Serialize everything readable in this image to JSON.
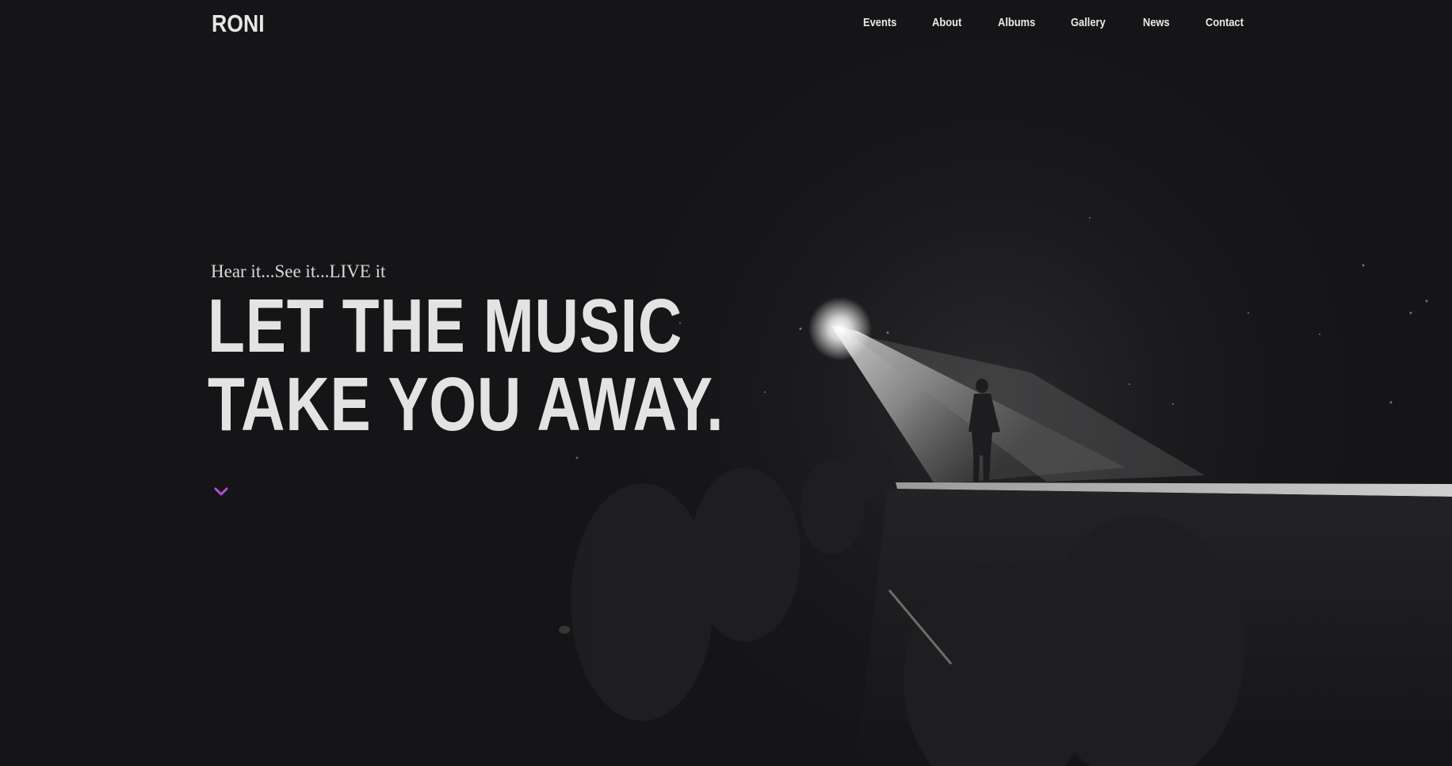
{
  "header": {
    "brand": "RONI",
    "nav": [
      {
        "label": "Events"
      },
      {
        "label": "About"
      },
      {
        "label": "Albums"
      },
      {
        "label": "Gallery"
      },
      {
        "label": "News"
      },
      {
        "label": "Contact"
      }
    ]
  },
  "hero": {
    "tagline": "Hear it...See it...LIVE it",
    "headline_line1": "LET THE MUSIC",
    "headline_line2": "TAKE YOU AWAY.",
    "scroll_icon": "chevron-down-icon"
  },
  "colors": {
    "background": "#151517",
    "text": "#e4e4e4",
    "accent": "#b24fd6"
  }
}
